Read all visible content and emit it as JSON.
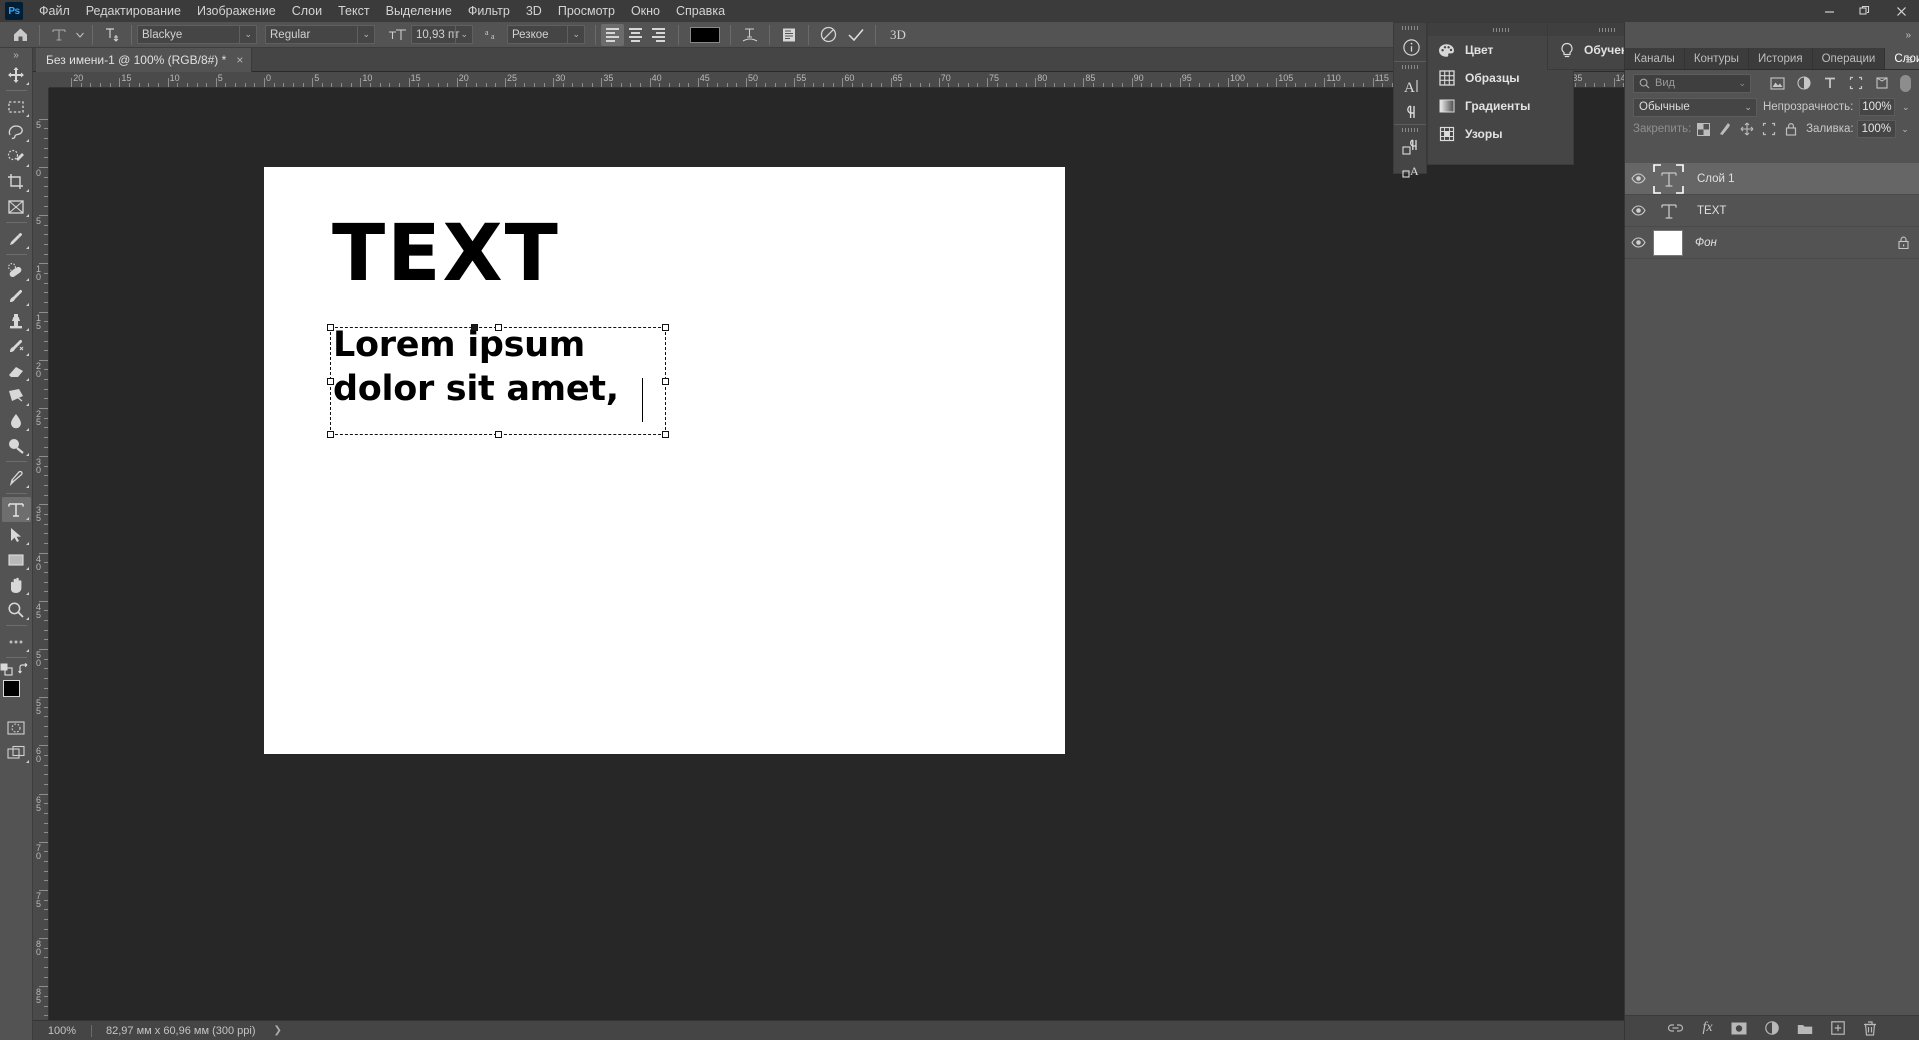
{
  "app": {
    "logo_text": "Ps",
    "menus": [
      "Файл",
      "Редактирование",
      "Изображение",
      "Слои",
      "Текст",
      "Выделение",
      "Фильтр",
      "3D",
      "Просмотр",
      "Окно",
      "Справка"
    ],
    "window_controls": {
      "minimize": "minimize-icon",
      "restore": "restore-icon",
      "close": "close-icon"
    }
  },
  "options_bar": {
    "home_icon": "home-icon",
    "tool_preset": "type-tool-icon",
    "orientation_icon": "text-orientation-icon",
    "font_family": "Blackye",
    "font_style": "Regular",
    "size_icon": "font-size-icon",
    "font_size": "10,93 пт",
    "antialias_icon": "anti-alias-icon",
    "antialias": "Резкое",
    "align": {
      "left": "align-left",
      "center": "align-center",
      "right": "align-right",
      "active": "left"
    },
    "color_swatch": "#000000",
    "warp_icon": "warp-text-icon",
    "panel_icon": "character-paragraph-panels-icon",
    "cancel_icon": "cancel-icon",
    "commit_icon": "commit-icon",
    "three_d_label": "3D",
    "search_icon": "search-icon",
    "workspace_icon": "workspace-icon",
    "share_icon": "share-icon"
  },
  "document": {
    "tab_title": "Без имени-1 @ 100% (RGB/8#) *",
    "close_glyph": "×"
  },
  "toolbar": {
    "expand_glyph": "»",
    "tools": [
      {
        "name": "move-tool",
        "active": false
      },
      {
        "name": "rectangular-marquee-tool",
        "active": false
      },
      {
        "name": "lasso-tool",
        "active": false
      },
      {
        "name": "quick-selection-tool",
        "active": false
      },
      {
        "name": "crop-tool",
        "active": false
      },
      {
        "name": "frame-tool",
        "active": false
      },
      {
        "name": "eyedropper-tool",
        "active": false
      },
      {
        "name": "healing-brush-tool",
        "active": false
      },
      {
        "name": "brush-tool",
        "active": false
      },
      {
        "name": "clone-stamp-tool",
        "active": false
      },
      {
        "name": "history-brush-tool",
        "active": false
      },
      {
        "name": "eraser-tool",
        "active": false
      },
      {
        "name": "gradient-tool",
        "active": false
      },
      {
        "name": "blur-tool",
        "active": false
      },
      {
        "name": "dodge-tool",
        "active": false
      },
      {
        "name": "pen-tool",
        "active": false
      },
      {
        "name": "type-tool",
        "active": true
      },
      {
        "name": "path-selection-tool",
        "active": false
      },
      {
        "name": "rectangle-tool",
        "active": false
      },
      {
        "name": "hand-tool",
        "active": false
      },
      {
        "name": "zoom-tool",
        "active": false
      },
      {
        "name": "edit-toolbar-tool",
        "active": false
      }
    ],
    "foreground_color": "#000000",
    "background_color": "#f6dcdc",
    "swap_icon": "swap-colors-icon",
    "default_icon": "default-colors-icon",
    "quickmask_icon": "quick-mask-icon",
    "screenmode_icon": "screen-mode-icon"
  },
  "rulers": {
    "unit": "мм",
    "horizontal_labels": [
      "20",
      "15",
      "10",
      "5",
      "0",
      "5",
      "10",
      "15",
      "20",
      "25",
      "30",
      "35",
      "40",
      "45",
      "50",
      "55",
      "60",
      "65",
      "70",
      "75",
      "80",
      "85"
    ],
    "vertical_labels": [
      "0",
      "5",
      "0",
      "5",
      "10",
      "15",
      "20",
      "25",
      "30",
      "35",
      "40",
      "45",
      "50",
      "55",
      "60",
      "65"
    ]
  },
  "canvas": {
    "heading_text": "TEXT",
    "textbox_lines": [
      "Lorem ipsum",
      "dolor sit amet,"
    ],
    "artboard_color": "#ffffff",
    "workspace_color": "#272727"
  },
  "status_bar": {
    "zoom": "100%",
    "dimensions": "82,97 мм x 60,96 мм (300 ppi)",
    "arrow_glyph": "❯"
  },
  "floating_dock": {
    "chevron": "»",
    "close_glyph": "✕",
    "buttons": [
      {
        "name": "info-panel-icon",
        "label": "Инфо"
      },
      {
        "name": "character-panel-icon",
        "label": "Символ"
      },
      {
        "name": "paragraph-panel-icon",
        "label": "Абзац"
      },
      {
        "name": "paragraph-styles-panel-icon",
        "label": "Стили абзацев"
      },
      {
        "name": "character-styles-panel-icon",
        "label": "Стили символов"
      }
    ]
  },
  "color_panel_menu": {
    "chevron": "»",
    "items": [
      {
        "label": "Цвет",
        "icon": "color-palette-icon"
      },
      {
        "label": "Образцы",
        "icon": "swatches-grid-icon"
      },
      {
        "label": "Градиенты",
        "icon": "gradients-icon"
      },
      {
        "label": "Узоры",
        "icon": "patterns-icon"
      }
    ]
  },
  "learn_panel": {
    "chevron": "»",
    "label": "Обучение",
    "icon": "lightbulb-icon"
  },
  "right_dock": {
    "collapse_chevron": "»",
    "tabs": [
      {
        "label": "Каналы",
        "active": false
      },
      {
        "label": "Контуры",
        "active": false
      },
      {
        "label": "История",
        "active": false
      },
      {
        "label": "Операции",
        "active": false
      },
      {
        "label": "Слои",
        "active": true
      }
    ],
    "menu_glyph": "≡",
    "filter": {
      "placeholder": "Вид",
      "search_icon": "search-icon",
      "chevron": "⌄",
      "filter_icons": [
        "pixel-filter-icon",
        "adjustment-filter-icon",
        "type-filter-icon",
        "shape-filter-icon",
        "smart-object-filter-icon"
      ],
      "toggle_name": "filter-toggle"
    },
    "blend_mode": "Обычные",
    "opacity_label": "Непрозрачность:",
    "opacity_value": "100%",
    "lock_label": "Закрепить:",
    "lock_icons": [
      "lock-transparency-icon",
      "lock-image-icon",
      "lock-position-icon",
      "lock-artboard-icon",
      "lock-all-icon"
    ],
    "fill_label": "Заливка:",
    "fill_value": "100%",
    "layers": [
      {
        "name": "Слой 1",
        "type": "text",
        "selected": true,
        "visible": true,
        "locked": false,
        "italic": false
      },
      {
        "name": "TEXT",
        "type": "text",
        "selected": false,
        "visible": true,
        "locked": false,
        "italic": false
      },
      {
        "name": "Фон",
        "type": "background",
        "selected": false,
        "visible": true,
        "locked": true,
        "italic": true
      }
    ],
    "footer_icons": [
      {
        "name": "link-layers-icon",
        "glyph": "⛓"
      },
      {
        "name": "layer-style-fx-icon",
        "glyph": "fx"
      },
      {
        "name": "add-layer-mask-icon",
        "glyph": "◧"
      },
      {
        "name": "new-adjustment-layer-icon",
        "glyph": "◐"
      },
      {
        "name": "new-group-icon",
        "glyph": "🗀"
      },
      {
        "name": "new-layer-icon",
        "glyph": "+"
      },
      {
        "name": "delete-layer-icon",
        "glyph": "🗑"
      }
    ]
  },
  "colors": {
    "chrome": "#535353",
    "panel": "#454545",
    "menubar": "#3b3b3b",
    "workspace": "#272727",
    "accent_text": "#e0e0e0"
  }
}
